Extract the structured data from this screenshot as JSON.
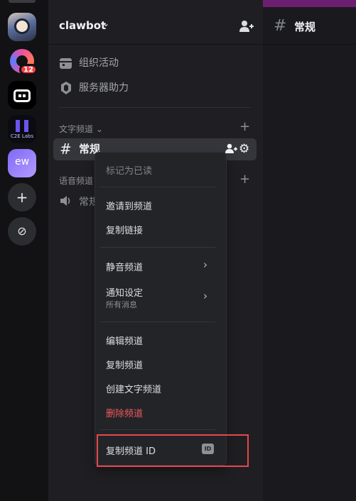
{
  "server_rail": {
    "servers": [
      {
        "name": "avatar-server"
      },
      {
        "name": "ring-server",
        "badge": "12"
      },
      {
        "name": "bot-server"
      },
      {
        "name": "c2e-labs-server",
        "logo_text": "C2E Labs"
      },
      {
        "name": "ew-server",
        "logo_text": "ew"
      }
    ],
    "add_symbol": "+",
    "explore_symbol": "⊘"
  },
  "sidebar": {
    "server_name": "clawbot",
    "nav": [
      {
        "label": "组织活动",
        "icon": "calendar-icon"
      },
      {
        "label": "服务器助力",
        "icon": "boost-icon"
      }
    ],
    "categories": {
      "text": "文字频道",
      "voice": "语音频道"
    },
    "text_channel": "常规",
    "voice_channel": "常规"
  },
  "main": {
    "channel_name": "常规"
  },
  "context_menu": {
    "mark_read": "标记为已读",
    "invite": "邀请到频道",
    "copy_link": "复制链接",
    "mute": "静音频道",
    "notify": "通知设定",
    "notify_sub": "所有消息",
    "edit": "编辑频道",
    "duplicate": "复制频道",
    "create_text": "创建文字频道",
    "delete": "删除频道",
    "copy_id": "复制频道 ID",
    "id_badge": "ID"
  },
  "colors": {
    "accent_strip": "#6c1f71",
    "danger": "#f0595c",
    "highlight_box": "#e5484d"
  }
}
